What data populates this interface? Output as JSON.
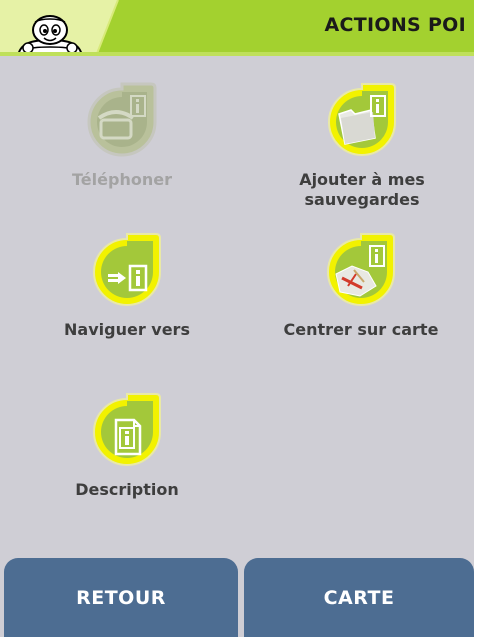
{
  "header": {
    "title": "ACTIONS POI",
    "mascot_icon": "michelin-mascot-icon",
    "accent_color": "#a3d12f"
  },
  "actions": [
    {
      "label": "Téléphoner",
      "icon": "phone-info-icon",
      "enabled": false
    },
    {
      "label": "Ajouter à mes\nsauvegardes",
      "icon": "folder-info-icon",
      "enabled": true
    },
    {
      "label": "Naviguer vers",
      "icon": "navigate-info-icon",
      "enabled": true
    },
    {
      "label": "Centrer sur carte",
      "icon": "map-center-info-icon",
      "enabled": true
    },
    {
      "label": "Description",
      "icon": "description-info-icon",
      "enabled": true
    }
  ],
  "footer": {
    "back_label": "RETOUR",
    "map_label": "CARTE",
    "button_color": "#4d6d92"
  }
}
